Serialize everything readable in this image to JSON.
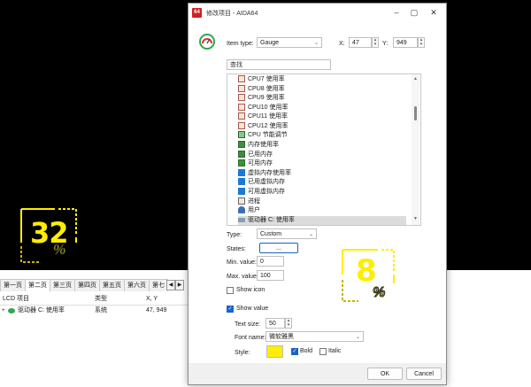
{
  "dialog": {
    "title": "修改项目 - AIDA64",
    "app_icon": "64",
    "item_type_label": "Item type:",
    "item_type_value": "Gauge",
    "x_label": "X:",
    "x_value": "47",
    "y_label": "Y:",
    "y_value": "949",
    "search_placeholder": "查找",
    "list_items": [
      {
        "label": "CPU7 使用率",
        "icon": "hourglass-icon"
      },
      {
        "label": "CPU8 使用率",
        "icon": "hourglass-icon"
      },
      {
        "label": "CPU9 使用率",
        "icon": "hourglass-icon"
      },
      {
        "label": "CPU10 使用率",
        "icon": "hourglass-icon"
      },
      {
        "label": "CPU11 使用率",
        "icon": "hourglass-icon"
      },
      {
        "label": "CPU12 使用率",
        "icon": "hourglass-icon"
      },
      {
        "label": "CPU 节能调节",
        "icon": "chip-icon"
      },
      {
        "label": "内存使用率",
        "icon": "memory-icon"
      },
      {
        "label": "已用内存",
        "icon": "memory-icon"
      },
      {
        "label": "可用内存",
        "icon": "memory-icon"
      },
      {
        "label": "虚拟内存使用率",
        "icon": "windows-icon"
      },
      {
        "label": "已用虚拟内存",
        "icon": "windows-icon"
      },
      {
        "label": "可用虚拟内存",
        "icon": "windows-icon"
      },
      {
        "label": "进程",
        "icon": "process-icon"
      },
      {
        "label": "用户",
        "icon": "user-icon"
      },
      {
        "label": "驱动器 C: 使用率",
        "icon": "drive-icon",
        "selected": true
      }
    ],
    "type_label": "Type:",
    "type_value": "Custom",
    "states_label": "States:",
    "states_button": "...",
    "min_label": "Min. value:",
    "min_value": "0",
    "max_label": "Max. value:",
    "max_value": "100",
    "show_icon_label": "Show icon",
    "show_icon_checked": false,
    "show_value_label": "Show value",
    "show_value_checked": true,
    "text_size_label": "Text size:",
    "text_size_value": "50",
    "font_name_label": "Font name:",
    "font_name_value": "微软雅黑",
    "style_label": "Style:",
    "style_color": "#ffee00",
    "bold_label": "Bold",
    "bold_checked": true,
    "italic_label": "Italic",
    "italic_checked": false,
    "ok_label": "OK",
    "cancel_label": "Cancel",
    "preview_value": "8",
    "preview_unit": "%"
  },
  "left_gauge": {
    "value": "32",
    "unit": "%"
  },
  "lcd": {
    "pages": [
      "第一页",
      "第二页",
      "第三页",
      "第四页",
      "第五页",
      "第六页",
      "第七"
    ],
    "active_page": 1,
    "columns": [
      "LCD 项目",
      "类型",
      "X, Y"
    ],
    "rows": [
      {
        "name": "驱动器 C: 使用率",
        "type": "系统",
        "xy": "47, 949"
      }
    ]
  },
  "colors": {
    "accent": "#1a63c8",
    "gauge_yellow": "#ffee00",
    "gauge_dark": "#b8b000"
  }
}
